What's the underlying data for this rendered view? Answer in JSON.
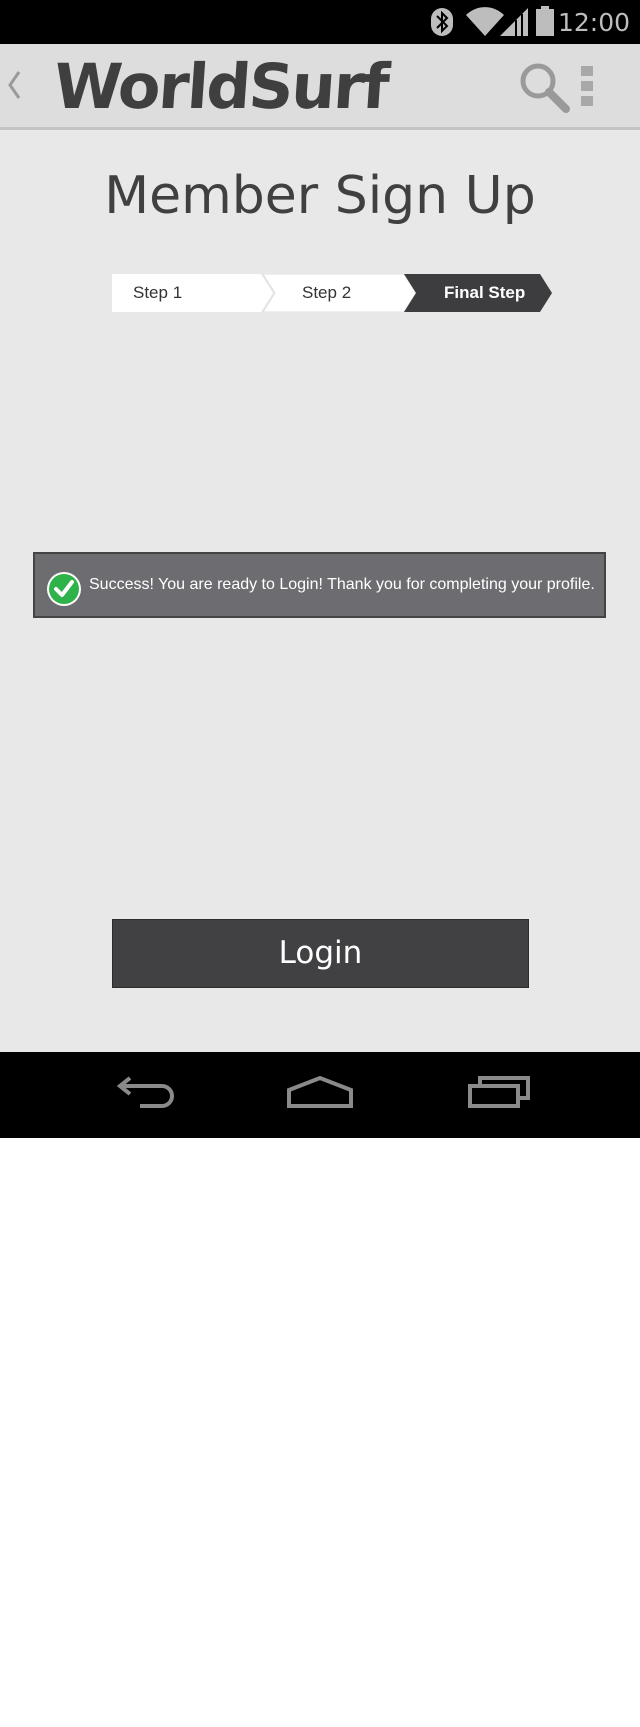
{
  "status_bar": {
    "time": "12:00",
    "icons": [
      "bluetooth-icon",
      "wifi-icon",
      "cell-signal-icon",
      "battery-icon"
    ]
  },
  "action_bar": {
    "app_name": "WorldSurf",
    "icons": [
      "back-icon",
      "search-icon",
      "overflow-menu-icon"
    ]
  },
  "page": {
    "title": "Member Sign Up"
  },
  "steps": [
    {
      "label": "Step 1",
      "active": false
    },
    {
      "label": "Step 2",
      "active": false
    },
    {
      "label": "Final Step",
      "active": true
    }
  ],
  "alert": {
    "icon": "check-circle-icon",
    "message": "Success! You are ready to Login! Thank you for completing your profile."
  },
  "login_button": {
    "label": "Login"
  },
  "nav_bar": {
    "icons": [
      "back-nav-icon",
      "home-nav-icon",
      "recents-nav-icon"
    ]
  },
  "colors": {
    "action_bar_bg": "#dddddd",
    "content_bg": "#e8e8e8",
    "active_step_bg": "#3d3d40",
    "alert_bg": "#6d6d71",
    "button_bg": "#414143",
    "success_green": "#2fb24a"
  }
}
